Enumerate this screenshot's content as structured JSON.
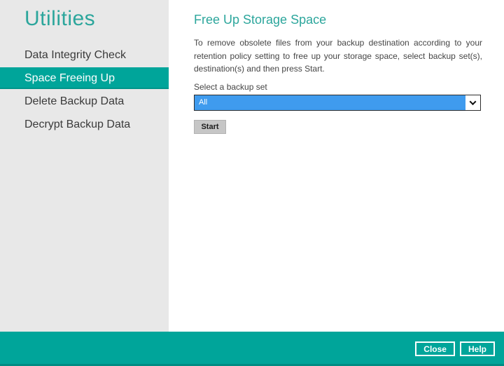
{
  "colors": {
    "accent": "#00a59a",
    "heading": "#2ca69c",
    "sidebar_bg": "#e8e8e8",
    "sidebar_text": "#3a3a3a",
    "body_text": "#454545",
    "select_blue": "#3f9bee",
    "select_border": "#2e2e2e",
    "start_bg": "#c6c6c6"
  },
  "sidebar": {
    "title": "Utilities",
    "items": [
      {
        "label": "Data Integrity Check",
        "selected": false
      },
      {
        "label": "Space Freeing Up",
        "selected": true
      },
      {
        "label": "Delete Backup Data",
        "selected": false
      },
      {
        "label": "Decrypt Backup Data",
        "selected": false
      }
    ]
  },
  "main": {
    "heading": "Free Up Storage Space",
    "description": "To remove obsolete files from your backup destination according to your retention policy setting to free up your storage space, select backup set(s), destination(s) and then press Start.",
    "select_label": "Select a backup set",
    "select_value": "All",
    "start_label": "Start"
  },
  "footer": {
    "close_label": "Close",
    "help_label": "Help"
  }
}
